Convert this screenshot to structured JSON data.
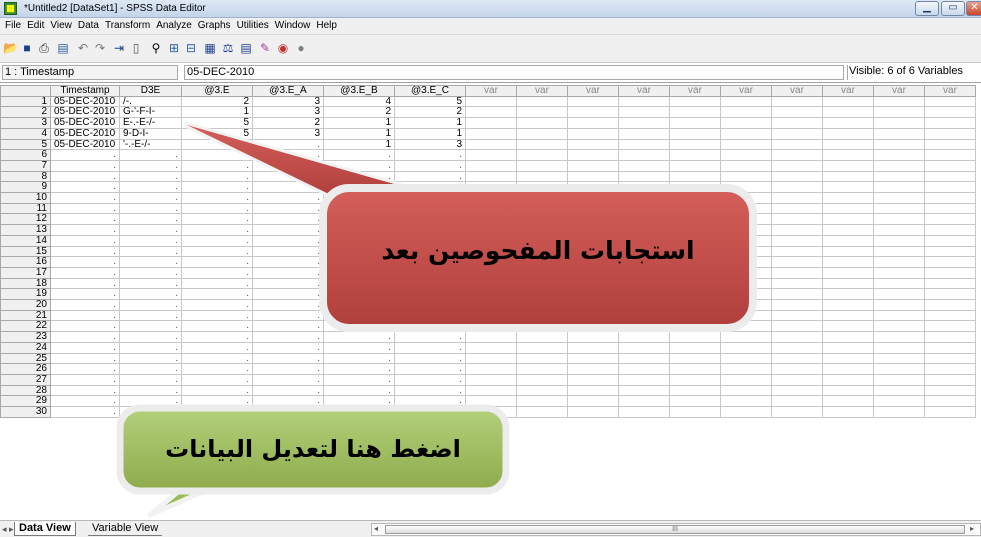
{
  "window": {
    "title": "*Untitled2 [DataSet1] - SPSS Data Editor",
    "app_icon": "spss-app-icon"
  },
  "menu": [
    "File",
    "Edit",
    "View",
    "Data",
    "Transform",
    "Analyze",
    "Graphs",
    "Utilities",
    "Window",
    "Help"
  ],
  "toolbar_icons": [
    "open-icon",
    "save-icon",
    "print-icon",
    "dialog-recall-icon",
    "undo-icon",
    "redo-icon",
    "goto-case-icon",
    "variables-icon",
    "find-icon",
    "insert-cases-icon",
    "insert-variable-icon",
    "split-file-icon",
    "weight-cases-icon",
    "select-cases-icon",
    "value-labels-icon",
    "use-sets-icon",
    "show-all-icon"
  ],
  "cellbar": {
    "ref": "1 : Timestamp",
    "value": "05-DEC-2010",
    "visible": "Visible: 6 of 6 Variables"
  },
  "grid": {
    "headers": [
      "Timestamp",
      "D3E",
      "@3.E",
      "@3.E_A",
      "@3.E_B",
      "@3.E_C",
      "var",
      "var",
      "var",
      "var",
      "var",
      "var",
      "var",
      "var",
      "var",
      "var"
    ],
    "rows": [
      [
        "05-DEC-2010",
        "/-.",
        "2",
        "3",
        "4",
        "5"
      ],
      [
        "05-DEC-2010",
        "G-'-F-I-",
        "1",
        "3",
        "2",
        "2"
      ],
      [
        "05-DEC-2010",
        "E-.-E-/-",
        "5",
        "2",
        "1",
        "1"
      ],
      [
        "05-DEC-2010",
        "9-D-I-",
        "5",
        "3",
        "1",
        "1"
      ],
      [
        "05-DEC-2010",
        "'-.-E-/-",
        "3",
        "",
        "1",
        "3"
      ]
    ],
    "row_count": 30,
    "missing_mark": "."
  },
  "tabs": {
    "data_view": "Data View",
    "variable_view": "Variable View"
  },
  "scroll": {
    "thumb_grip": "III"
  },
  "callouts": {
    "responses": "استجابات المفحوصين بعد",
    "edit": "اضغط هنا لتعديل البيانات"
  },
  "colors": {
    "callout_red": "#c0504d",
    "callout_green": "#9bbb59",
    "accent_titlebar": "#c3d4e9"
  }
}
